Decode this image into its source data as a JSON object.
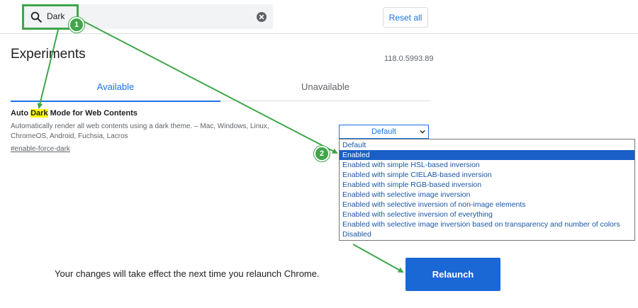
{
  "search": {
    "value": "Dark"
  },
  "header": {
    "reset_label": "Reset all"
  },
  "page": {
    "title": "Experiments",
    "version": "118.0.5993.89"
  },
  "tabs": [
    {
      "label": "Available"
    },
    {
      "label": "Unavailable"
    }
  ],
  "experiment": {
    "title_before": "Auto ",
    "title_highlight": "Dark",
    "title_after": " Mode for Web Contents",
    "description": "Automatically render all web contents using a dark theme. – Mac, Windows, Linux, ChromeOS, Android, Fuchsia, Lacros",
    "link": "#enable-force-dark",
    "selected_value": "Default",
    "options": [
      "Default",
      "Enabled",
      "Enabled with simple HSL-based inversion",
      "Enabled with simple CIELAB-based inversion",
      "Enabled with simple RGB-based inversion",
      "Enabled with selective image inversion",
      "Enabled with selective inversion of non-image elements",
      "Enabled with selective inversion of everything",
      "Enabled with selective image inversion based on transparency and number of colors",
      "Disabled"
    ],
    "highlighted_option": "Enabled"
  },
  "footer": {
    "message": "Your changes will take effect the next time you relaunch Chrome.",
    "relaunch_label": "Relaunch"
  },
  "annotations": {
    "step1": "1",
    "step2": "2",
    "color": "#3fa64a"
  }
}
